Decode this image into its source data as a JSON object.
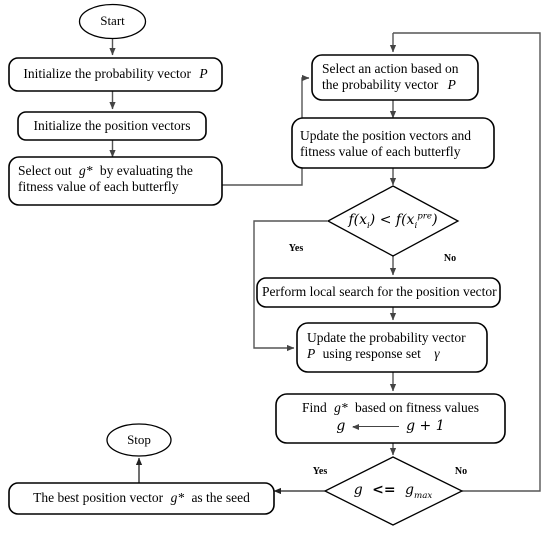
{
  "diagram": {
    "title": "Monarch Butterfly Optimization flowchart",
    "type": "flowchart",
    "stroke_color": "#000000",
    "connector_color": "#555555",
    "background": "#ffffff"
  },
  "nodes": {
    "start": {
      "label": "Start",
      "shape": "ellipse"
    },
    "init_prob": {
      "label_1": "Initialize the probability vector",
      "label_2": "P",
      "shape": "rounded-rect"
    },
    "init_pos": {
      "label_1": "Initialize the position vectors",
      "shape": "rounded-rect"
    },
    "select_g": {
      "label_1": "Select out",
      "label_2": "g*",
      "label_3": "by evaluating the",
      "label_4": "fitness value of each butterfly",
      "shape": "rounded-rect"
    },
    "select_action": {
      "label_1": "Select an action based on",
      "label_2": "the probability vector",
      "label_3": "P",
      "shape": "rounded-rect"
    },
    "update_pos": {
      "label_1": "Update the position vectors and",
      "label_2": "fitness value of each butterfly",
      "shape": "rounded-rect"
    },
    "decision_fitness": {
      "label": "f(xᵢ) < f(xᵢ^pre)",
      "shape": "diamond"
    },
    "local_search": {
      "label_1": "Perform local search for the position vector",
      "shape": "rounded-rect"
    },
    "update_prob": {
      "label_1": "Update the probability vector",
      "label_2": "P",
      "label_3": "using response set",
      "label_4": "γ",
      "shape": "rounded-rect"
    },
    "find_g": {
      "label_1": "Find",
      "label_2": "g*",
      "label_3": "based on fitness values",
      "label_4_left": "g",
      "label_4_right": "g + 1",
      "shape": "rounded-rect"
    },
    "decision_gmax": {
      "label_1": "g",
      "label_2": "<=",
      "label_3": "g",
      "label_3_sub": "max",
      "shape": "diamond"
    },
    "best_seed": {
      "label_1": "The best position vector",
      "label_2": "g*",
      "label_3": "as the seed",
      "shape": "rounded-rect"
    },
    "stop": {
      "label": "Stop",
      "shape": "ellipse"
    }
  },
  "edge_labels": {
    "fitness_yes": "Yes",
    "fitness_no": "No",
    "gmax_yes": "Yes",
    "gmax_no": "No"
  }
}
